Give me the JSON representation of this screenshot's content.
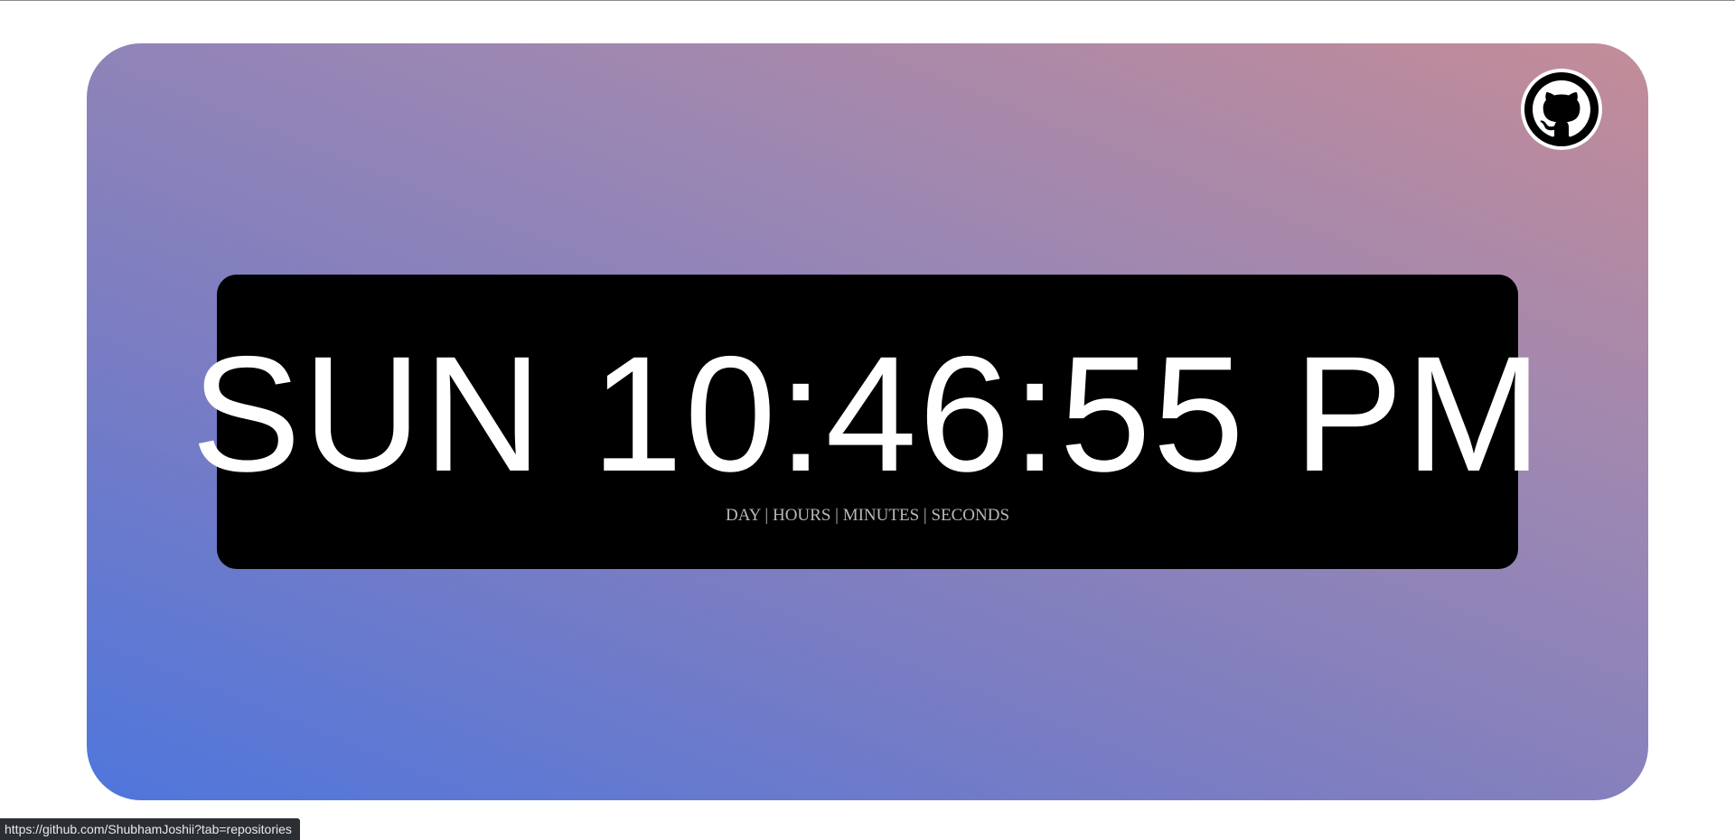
{
  "page": {
    "background_color": "#ffffff",
    "card_gradient": [
      "#4f76dc",
      "#7b7dc2",
      "#9b87b3",
      "#c48c98"
    ]
  },
  "github": {
    "icon": "github-octocat-icon",
    "aria_label": "GitHub"
  },
  "clock": {
    "display": "SUN 10:46:55 PM",
    "labels": "DAY | HOURS | MINUTES | SECONDS",
    "panel_color": "#000000",
    "text_color": "#ffffff"
  },
  "status_bar": {
    "url": "https://github.com/ShubhamJoshii?tab=repositories"
  }
}
